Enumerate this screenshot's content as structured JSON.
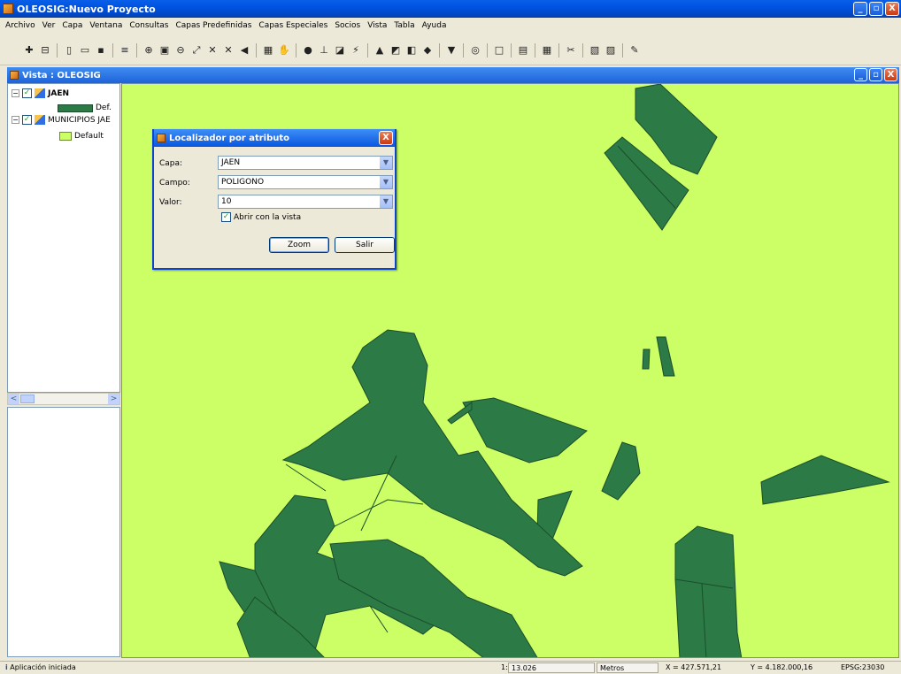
{
  "window": {
    "title": "OLEOSIG:Nuevo Proyecto",
    "controls": [
      "_",
      "▫",
      "X"
    ]
  },
  "menu": [
    "Archivo",
    "Ver",
    "Capa",
    "Ventana",
    "Consultas",
    "Capas Predefinidas",
    "Capas Especiales",
    "Socios",
    "Vista",
    "Tabla",
    "Ayuda"
  ],
  "toolbar_icons": [
    "add-layer-icon",
    "remove-layer-icon",
    "sep",
    "new-icon",
    "open-icon",
    "save-icon",
    "sep",
    "layers-icon",
    "sep",
    "zoom-in-icon",
    "zoom-window-icon",
    "zoom-out-icon",
    "full-extent-icon",
    "zoom-select-icon",
    "zoom-layer-icon",
    "zoom-prev-icon",
    "sep",
    "pan-icon",
    "hand-icon",
    "sep",
    "info-icon",
    "measure-icon",
    "area-icon",
    "hyperlink-icon",
    "sep",
    "select-icon",
    "select-rect-icon",
    "select-poly-icon",
    "select-layer-icon",
    "sep",
    "filter-icon",
    "sep",
    "locate-icon",
    "sep",
    "rectangle-icon",
    "sep",
    "table-icon",
    "sep",
    "grid-icon",
    "sep",
    "tools-icon",
    "sep",
    "export-icon",
    "export-pdf-icon",
    "sep",
    "edit-icon"
  ],
  "view": {
    "title": "Vista : OLEOSIG"
  },
  "toc": {
    "layers": [
      {
        "name": "JAEN",
        "legend": "Def.",
        "color": "#2C7A45",
        "checked": "✓"
      },
      {
        "name": "MUNICIPIOS JAE",
        "legend": "Default",
        "color": "#CCFF66",
        "checked": "✓"
      }
    ],
    "scroll_left": "<",
    "scroll_right": ">"
  },
  "dialog": {
    "title": "Localizador por atributo",
    "close": "X",
    "fields": [
      {
        "label": "Capa:",
        "value": "JAEN"
      },
      {
        "label": "Campo:",
        "value": "POLIGONO"
      },
      {
        "label": "Valor:",
        "value": "10"
      }
    ],
    "checkbox": {
      "label": "Abrir con la vista",
      "checked": "✓"
    },
    "zoom_button": "Zoom",
    "exit_button": "Salir"
  },
  "map": {
    "background": "#CCFF66",
    "parcel_color": "#2C7A45"
  },
  "status": {
    "message": "Aplicación iniciada",
    "scale_prefix": "1:",
    "scale": "13.026",
    "units": "Metros",
    "x": "X = 427.571,21",
    "y": "Y = 4.182.000,16",
    "crs": "EPSG:23030"
  }
}
